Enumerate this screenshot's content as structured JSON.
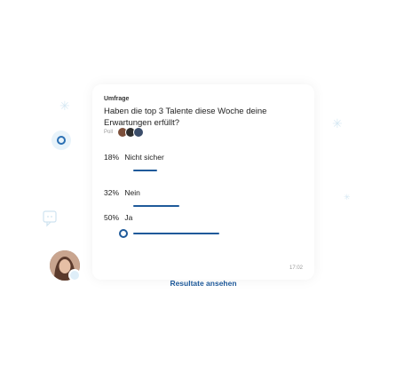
{
  "message": {
    "label": "Umfrage",
    "question": "Haben die top 3 Talente diese Woche deine Erwartungen erfüllt?",
    "poll_label": "Poll",
    "voter_avatar_colors": [
      "#7c4f3a",
      "#2e2e2e",
      "#3b4d6a"
    ],
    "options": [
      {
        "percent": "18%",
        "label": "Nicht sicher",
        "value": 0.18,
        "selected": false
      },
      {
        "percent": "32%",
        "label": "Nein",
        "value": 0.32,
        "selected": false
      },
      {
        "percent": "50%",
        "label": "Ja",
        "value": 0.5,
        "selected": true
      }
    ],
    "results_label": "Resultate ansehen",
    "time": "17:02"
  },
  "colors": {
    "accent": "#1f5a9a",
    "icon_bg": "#e8f3fa"
  },
  "icons": [
    "sparkle-icon",
    "poll-icon",
    "chat-icon",
    "avatar",
    "radio-check-icon"
  ]
}
